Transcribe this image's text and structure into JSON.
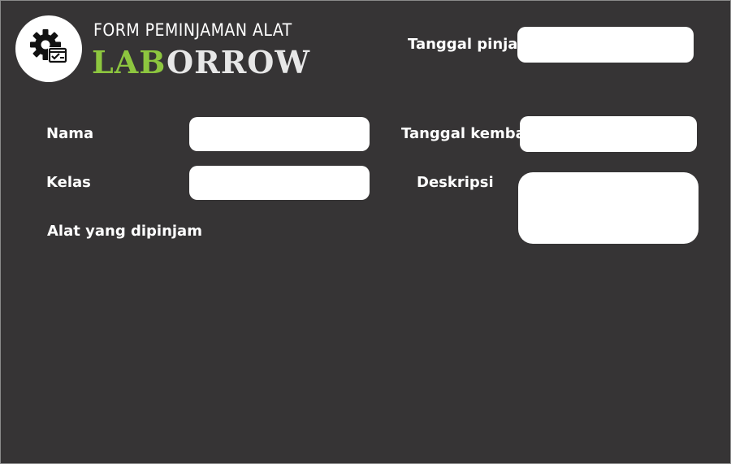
{
  "header": {
    "subtitle": "FORM PEMINJAMAN ALAT",
    "title_accent": "LAB",
    "title_rest": "ORROW",
    "logo_icon": "gear-checklist-icon"
  },
  "form": {
    "tanggal_pinjam": {
      "label": "Tanggal pinjam",
      "value": ""
    },
    "nama": {
      "label": "Nama",
      "value": ""
    },
    "tanggal_kembali": {
      "label": "Tanggal kembali",
      "value": ""
    },
    "kelas": {
      "label": "Kelas",
      "value": ""
    },
    "deskripsi": {
      "label": "Deskripsi",
      "value": ""
    },
    "alat": {
      "label": "Alat yang dipinjam"
    }
  },
  "colors": {
    "background": "#363435",
    "accent": "#8dc63f",
    "field": "#ffffff",
    "text": "#ffffff"
  }
}
